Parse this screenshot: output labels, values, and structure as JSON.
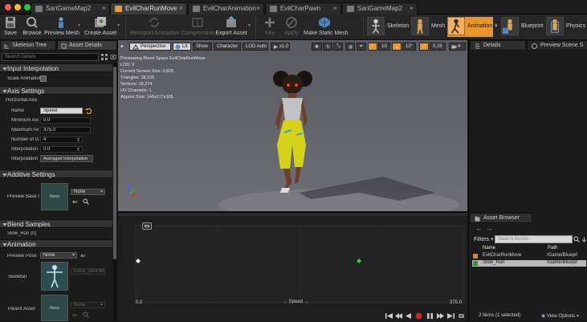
{
  "window": {
    "tabs": [
      {
        "label": "SariGameMap2",
        "active": false
      },
      {
        "label": "EvilCharRunMove",
        "active": true
      },
      {
        "label": "EvilCharAnimation",
        "active": false
      },
      {
        "label": "EvilCharPawn",
        "active": false
      },
      {
        "label": "SariGameMap2",
        "active": false
      }
    ]
  },
  "toolbar": {
    "save": "Save",
    "browse": "Browse",
    "preview_mesh": "Preview Mesh",
    "create_asset": "Create Asset",
    "reimport_animation": "Reimport Animation",
    "compression": "Compression",
    "export_asset": "Export Asset",
    "key": "Key",
    "apply": "Apply",
    "make_static_mesh": "Make Static Mesh",
    "modes": {
      "skeleton": "Skeleton",
      "mesh": "Mesh",
      "animation": "Animation",
      "blueprint": "Blueprint",
      "physics": "Physics"
    }
  },
  "left_panel": {
    "tabs": [
      "Skeleton Tree",
      "Asset Details"
    ],
    "search_placeholder": "Search Details",
    "sections": {
      "input_interpolation": "Input Interpolation",
      "axis_settings": "Axis Settings",
      "additive_settings": "Additive Settings",
      "blend_samples": "Blend Samples",
      "animation": "Animation"
    },
    "scale_animation_label": "Scale Animatior",
    "horizontal_axis_label": "Horizontal Axis",
    "axis_fields": [
      {
        "label": "Name",
        "value": "Speed"
      },
      {
        "label": "Minimum Axi",
        "value": "0.0"
      },
      {
        "label": "Maximum Ax",
        "value": "375.0"
      },
      {
        "label": "Number of Gri",
        "value": "4"
      },
      {
        "label": "Interpolation",
        "value": "0.0"
      },
      {
        "label": "Interpolation",
        "value": "Averaged Interpolation"
      }
    ],
    "preview_base_pose": {
      "label": "Preview Base P",
      "thumb": "None",
      "value": "None"
    },
    "blend_sample": "Slow_Run (0)",
    "preview_pose_asset": {
      "label": "Preview Pose A",
      "value": "None"
    },
    "skeleton": {
      "label": "Skeleton",
      "value": "Ch03_nonPBR"
    },
    "parent_asset": {
      "label": "Parent Asset",
      "thumb": "None",
      "value": "None"
    }
  },
  "viewport": {
    "buttons": [
      "Perspective",
      "Lit",
      "Show",
      "Character",
      "LOD Auto",
      "x1.0"
    ],
    "snap_values": [
      "10",
      "10°",
      "0.25",
      "4"
    ],
    "overlay": [
      "Previewing Blend Space EvilCharRunMove",
      "LOD: 0",
      "Current Screen Size: 0.825",
      "Triangles: 38,156",
      "Vertices: 18,274",
      "UV Channels: 1",
      "Approx Size: 146x177x105"
    ]
  },
  "blend_graph": {
    "axis_name": "Speed",
    "min_label": "0.0",
    "max_label": "375.0",
    "chart_data": {
      "type": "scatter",
      "xlabel": "Speed",
      "xlim": [
        0,
        375
      ],
      "points": [
        {
          "x": 0.0,
          "state": "sample"
        },
        {
          "x": 255.0,
          "state": "preview"
        }
      ]
    }
  },
  "right_panel": {
    "tabs": [
      "Details",
      "Preview Scene S"
    ],
    "asset_browser_tab": "Asset Browser",
    "filters_label": "Filters",
    "search_placeholder": "Search Assets",
    "columns": [
      "Name",
      "Path"
    ],
    "rows": [
      {
        "name": "EvilCharRunMove",
        "path": "/Game/Bluepri"
      },
      {
        "name": "Slow_Run",
        "path": "/Game/Bluepri"
      }
    ],
    "status": "2 items (1 selected)",
    "view_options": "View Options"
  },
  "colors": {
    "accent_orange": "#e8952a",
    "highlight_blue": "#2d5f91",
    "preview_green": "#2fd12f",
    "close": "#fd5f57",
    "minimize": "#febb2e",
    "maximize": "#27c840"
  }
}
